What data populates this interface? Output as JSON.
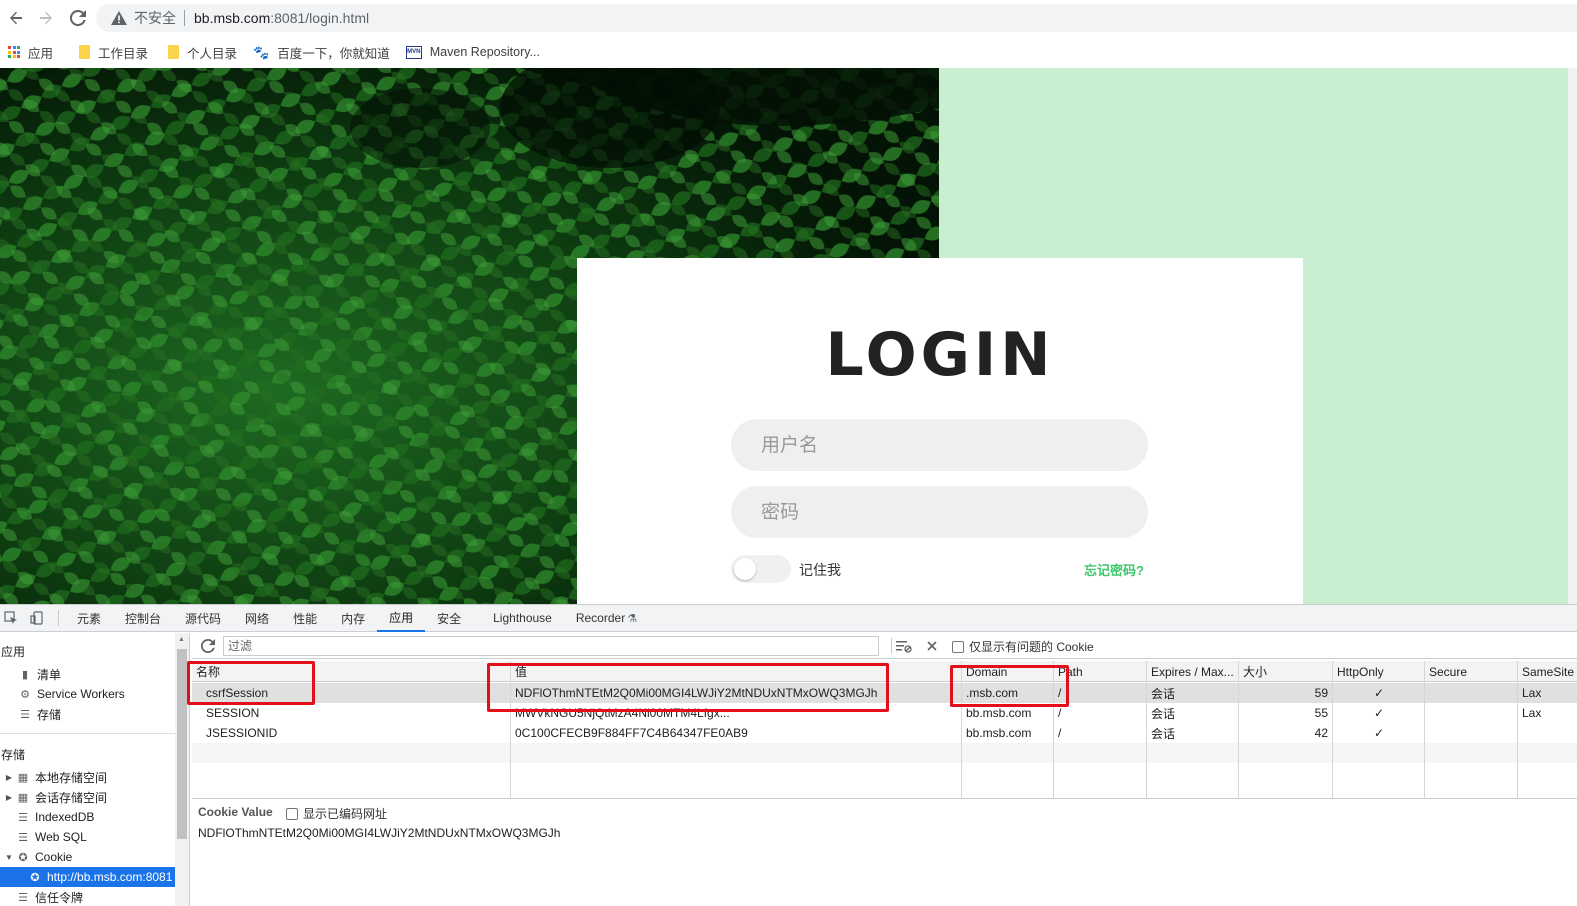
{
  "browser": {
    "insecure_label": "不安全",
    "url_host": "bb.msb.com",
    "url_rest": ":8081/login.html",
    "bookmarks": [
      {
        "label": "应用",
        "icon": "apps-grid-icon"
      },
      {
        "label": "工作目录",
        "icon": "folder-icon"
      },
      {
        "label": "个人目录",
        "icon": "folder-icon"
      },
      {
        "label": "百度一下，你就知道",
        "icon": "baidu-paw-icon"
      },
      {
        "label": "Maven Repository...",
        "icon": "maven-icon"
      }
    ]
  },
  "login": {
    "title": "LOGIN",
    "username_placeholder": "用户名",
    "password_placeholder": "密码",
    "remember_label": "记住我",
    "forgot_label": "忘记密码?",
    "accent_color": "#3ec66b"
  },
  "devtools": {
    "tabs": [
      "元素",
      "控制台",
      "源代码",
      "网络",
      "性能",
      "内存",
      "应用",
      "安全",
      "Lighthouse",
      "Recorder"
    ],
    "active_tab": "应用",
    "sidebar": {
      "app_header": "应用",
      "app_items": [
        "清单",
        "Service Workers",
        "存储"
      ],
      "storage_header": "存储",
      "storage_items": [
        "本地存储空间",
        "会话存储空间",
        "IndexedDB",
        "Web SQL",
        "Cookie"
      ],
      "cookie_origin": "http://bb.msb.com:8081",
      "trust_tokens": "信任令牌"
    },
    "toolbar": {
      "filter_placeholder": "过滤",
      "only_issues_label": "仅显示有问题的 Cookie"
    },
    "table": {
      "headers": [
        "名称",
        "值",
        "Domain",
        "Path",
        "Expires / Max...",
        "大小",
        "HttpOnly",
        "Secure",
        "SameSite"
      ],
      "rows": [
        {
          "name": "csrfSession",
          "value": "NDFlOThmNTEtM2Q0Mi00MGI4LWJiY2MtNDUxNTMxOWQ3MGJh",
          "domain": ".msb.com",
          "path": "/",
          "expires": "会话",
          "size": "59",
          "httponly": "✓",
          "secure": "",
          "samesite": "Lax"
        },
        {
          "name": "SESSION",
          "value": "MWVkNGU5NjQtMzA4Ni00MTM4Lfgx...",
          "domain": "bb.msb.com",
          "path": "/",
          "expires": "会话",
          "size": "55",
          "httponly": "✓",
          "secure": "",
          "samesite": "Lax"
        },
        {
          "name": "JSESSIONID",
          "value": "0C100CFECB9F884FF7C4B64347FE0AB9",
          "domain": "bb.msb.com",
          "path": "/",
          "expires": "会话",
          "size": "42",
          "httponly": "✓",
          "secure": "",
          "samesite": ""
        }
      ]
    },
    "cookie_value": {
      "title": "Cookie Value",
      "show_encoded_label": "显示已编码网址",
      "value": "NDFlOThmNTEtM2Q0Mi00MGI4LWJiY2MtNDUxNTMxOWQ3MGJh"
    },
    "highlight_color": "#e3101b"
  }
}
